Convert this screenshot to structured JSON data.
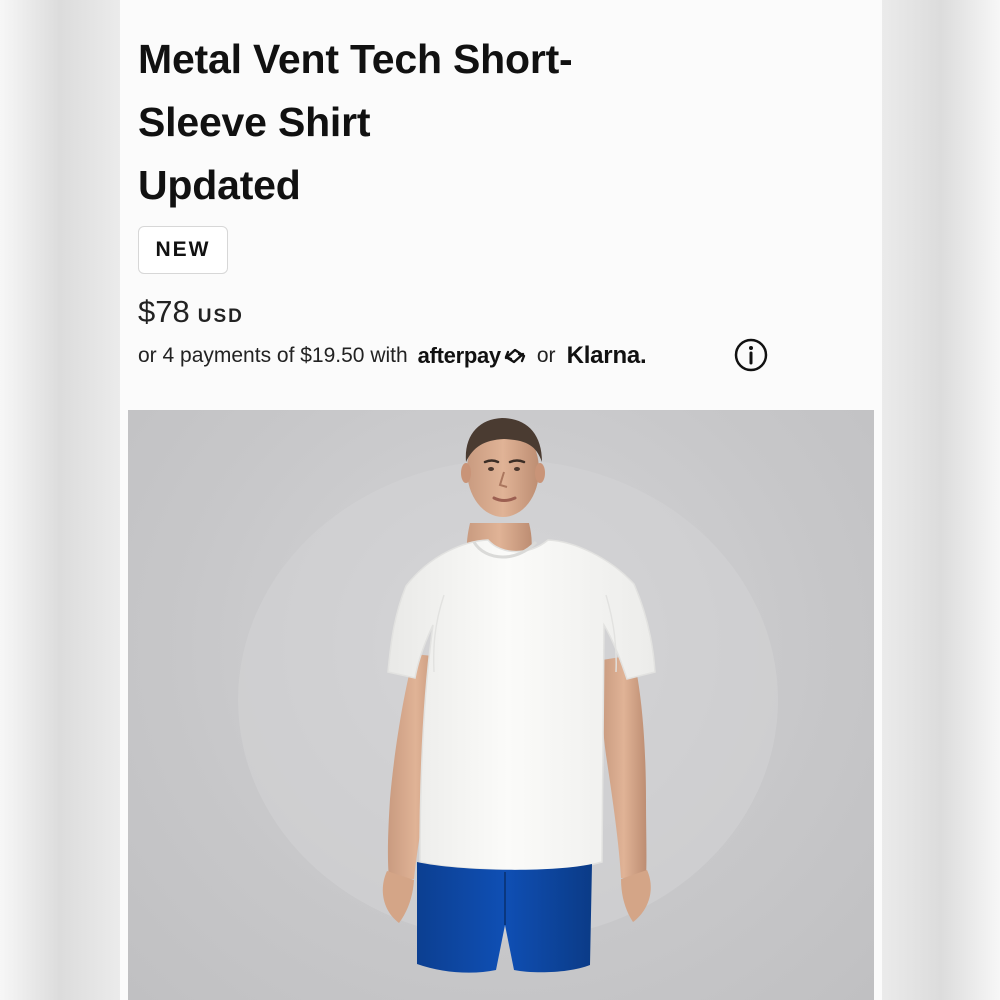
{
  "product": {
    "title_lines": [
      "Metal Vent Tech Short-",
      "Sleeve Shirt",
      "Updated"
    ],
    "badge": "NEW",
    "price": "$78",
    "currency": "USD"
  },
  "payment": {
    "text": "or 4 payments of $19.50 with",
    "afterpay_label": "afterpay",
    "or_text": "or",
    "klarna_label": "Klarna."
  },
  "icons": {
    "info": "info-icon",
    "afterpay": "afterpay-arrows-icon"
  },
  "colors": {
    "background": "#fbfbfb",
    "shorts": "#0f4fb4",
    "shirt": "#f7f7f5",
    "photo_background": "#c8c8ca"
  }
}
